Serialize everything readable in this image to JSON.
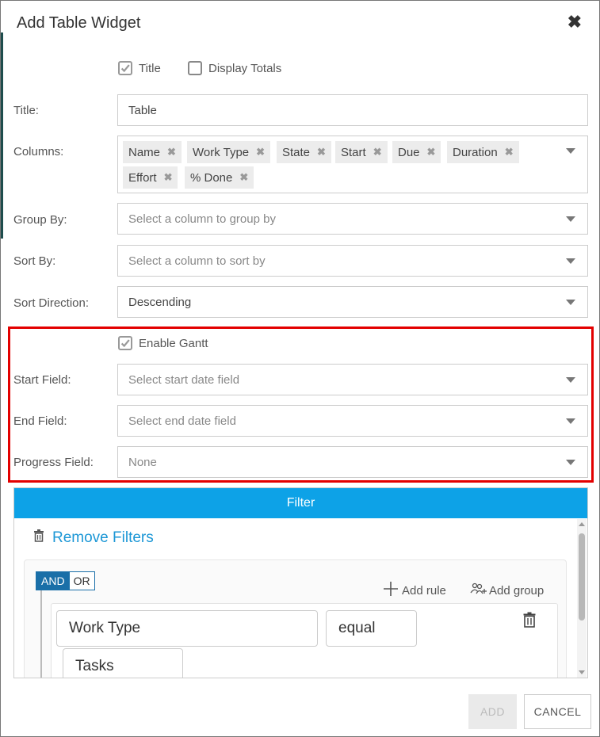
{
  "dialog": {
    "title": "Add Table Widget",
    "close_glyph": "✖"
  },
  "options": {
    "title_checkbox": {
      "label": "Title",
      "checked": true
    },
    "display_totals_checkbox": {
      "label": "Display Totals",
      "checked": false
    }
  },
  "form": {
    "title": {
      "label": "Title:",
      "value": "Table"
    },
    "columns": {
      "label": "Columns:",
      "tags": [
        "Name",
        "Work Type",
        "State",
        "Start",
        "Due",
        "Duration",
        "Effort",
        "% Done"
      ]
    },
    "group_by": {
      "label": "Group By:",
      "placeholder": "Select a column to group by"
    },
    "sort_by": {
      "label": "Sort By:",
      "placeholder": "Select a column to sort by"
    },
    "sort_direction": {
      "label": "Sort Direction:",
      "value": "Descending"
    }
  },
  "gantt": {
    "enable_checkbox": {
      "label": "Enable Gantt",
      "checked": true
    },
    "start_field": {
      "label": "Start Field:",
      "placeholder": "Select start date field"
    },
    "end_field": {
      "label": "End Field:",
      "placeholder": "Select end date field"
    },
    "progress_field": {
      "label": "Progress Field:",
      "value": "None"
    },
    "highlight_color": "#e30000"
  },
  "filter": {
    "header": "Filter",
    "header_color": "#0da2e7",
    "remove_filters": "Remove Filters",
    "and_label": "AND",
    "or_label": "OR",
    "add_rule": "Add rule",
    "add_group": "Add group",
    "rule": {
      "field": "Work Type",
      "operator": "equal",
      "value": "Tasks"
    }
  },
  "buttons": {
    "add": "ADD",
    "cancel": "CANCEL"
  }
}
